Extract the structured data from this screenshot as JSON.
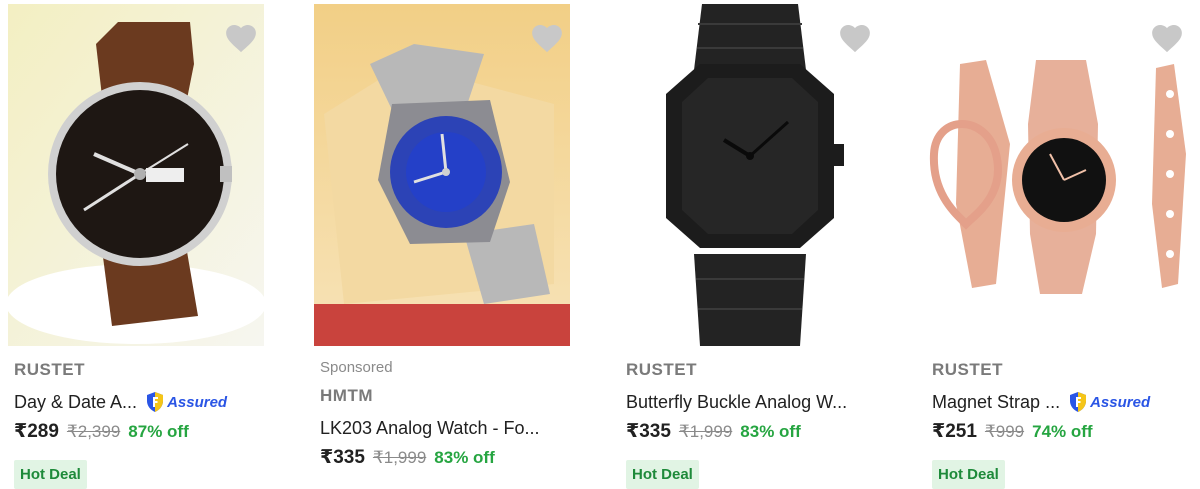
{
  "products": [
    {
      "image": "brown leather strap watch with black dial and day-date window",
      "brand": "RUSTET",
      "title": "Day & Date A...",
      "assured": true,
      "assured_label": "Assured",
      "price": "₹289",
      "mrp": "₹2,399",
      "discount": "87% off",
      "deal": "Hot Deal",
      "sponsored": ""
    },
    {
      "image": "silver steel watch with blue dial in gift box",
      "brand": "HMTM",
      "title": "LK203 Analog Watch - Fo...",
      "assured": false,
      "price": "₹335",
      "mrp": "₹1,999",
      "discount": "83% off",
      "deal": "",
      "sponsored": "Sponsored"
    },
    {
      "image": "all-black octagonal analog watch with link bracelet",
      "brand": "RUSTET",
      "title": "Butterfly Buckle Analog W...",
      "assured": false,
      "price": "₹335",
      "mrp": "₹1,999",
      "discount": "83% off",
      "deal": "Hot Deal",
      "sponsored": ""
    },
    {
      "image": "rose gold mesh strap watch with queen dial and two bracelets",
      "brand": "RUSTET",
      "title": "Magnet Strap ...",
      "assured": true,
      "assured_label": "Assured",
      "price": "₹251",
      "mrp": "₹999",
      "discount": "74% off",
      "deal": "Hot Deal",
      "sponsored": ""
    }
  ],
  "colors": {
    "assured_blue": "#2a55e5",
    "discount_green": "#26a541",
    "deal_bg": "#e1f4e4",
    "heart_gray": "#c8c8c8"
  },
  "icons": {
    "wishlist": "heart-icon",
    "assured": "assured-shield-icon"
  }
}
